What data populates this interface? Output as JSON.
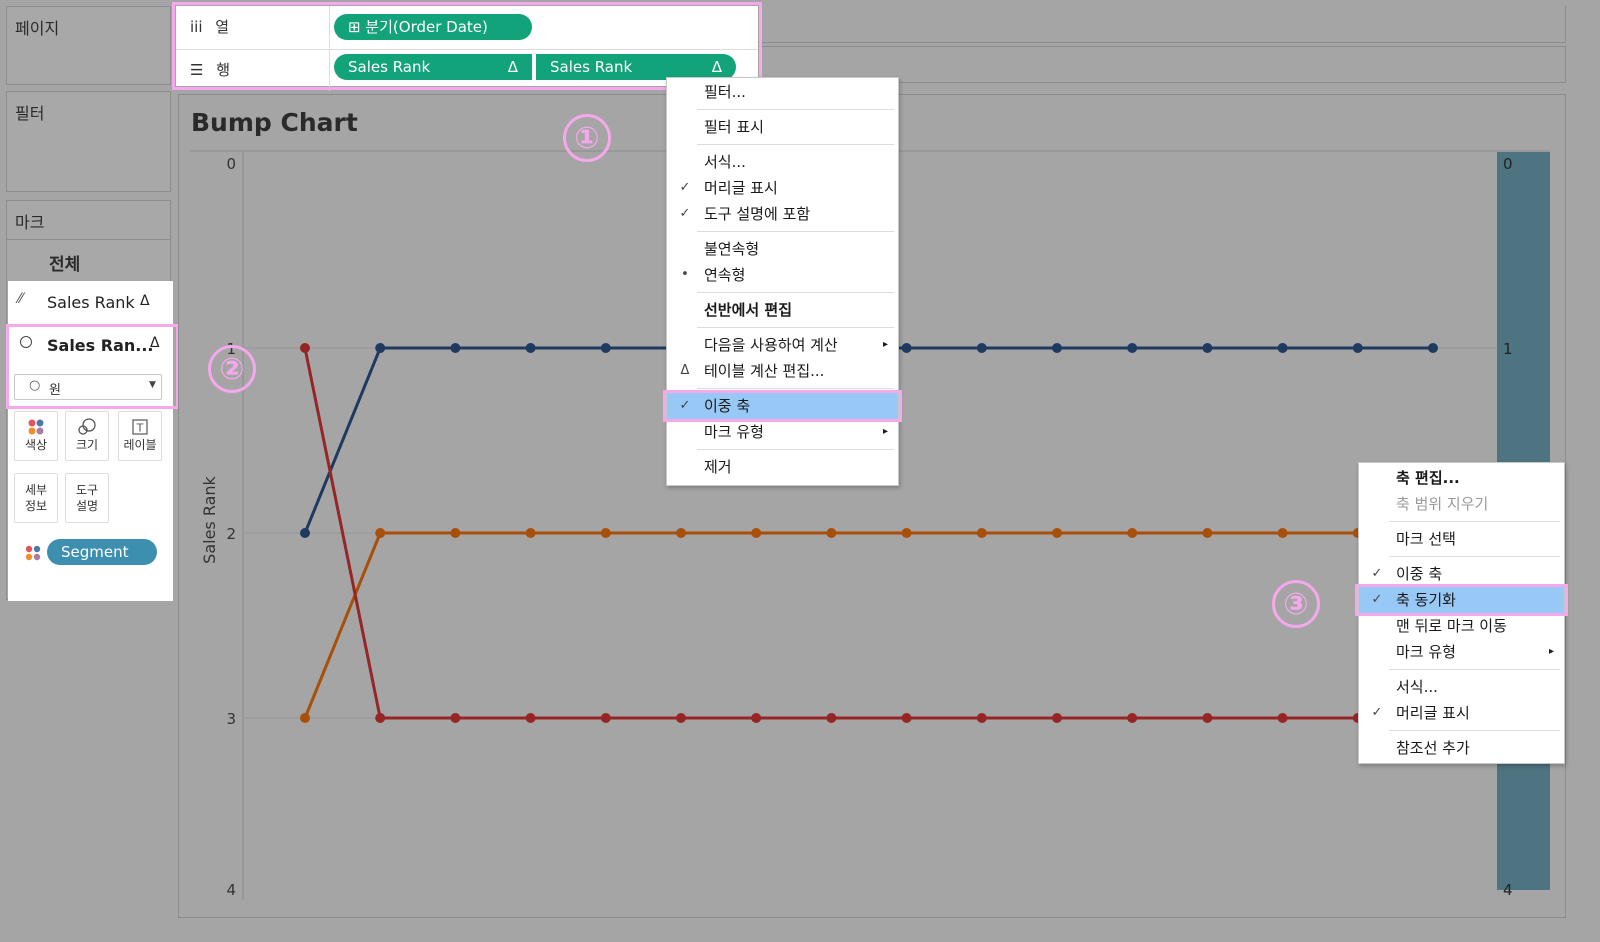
{
  "panels": {
    "pages_label": "페이지",
    "filters_label": "필터",
    "marks_label": "마크"
  },
  "marks": {
    "all_label": "전체",
    "layers": [
      {
        "icon": "line-chart-icon",
        "label": "Sales Rank",
        "delta": "Δ"
      },
      {
        "icon": "circle-outline-icon",
        "label": "Sales Ran...",
        "delta": "Δ"
      }
    ],
    "mark_type": {
      "icon": "○",
      "value": "원"
    },
    "tiles": [
      {
        "label": "색상",
        "icon": "color-dots-icon"
      },
      {
        "label": "크기",
        "icon": "size-circles-icon"
      },
      {
        "label": "레이블",
        "icon": "label-T-icon"
      },
      {
        "label": "세부\n정보",
        "icon": "detail-icon"
      },
      {
        "label": "도구\n설명",
        "icon": "tooltip-icon"
      }
    ],
    "segment_pill": "Segment"
  },
  "shelves": {
    "columns": {
      "icon": "iii",
      "label": "열",
      "pill": "⊞ 분기(Order Date)"
    },
    "rows": {
      "icon": "☰",
      "label": "행",
      "pills": [
        {
          "label": "Sales Rank",
          "delta": "Δ"
        },
        {
          "label": "Sales Rank",
          "delta": "Δ"
        }
      ]
    }
  },
  "chart_data": {
    "type": "line",
    "title": "Bump Chart",
    "ylabel": "Sales Rank",
    "ylim": [
      0,
      4
    ],
    "y_ticks": [
      "0",
      "1",
      "2",
      "3",
      "4"
    ],
    "right_axis_ticks": [
      "0",
      "1",
      "4"
    ],
    "x": [
      1,
      2,
      3,
      4,
      5,
      6,
      7,
      8,
      9,
      10,
      11,
      12,
      13,
      14,
      15,
      16
    ],
    "series": [
      {
        "color": "#1f3a5f",
        "values": [
          2,
          1,
          1,
          1,
          1,
          1,
          1,
          1,
          1,
          1,
          1,
          1,
          1,
          1,
          1,
          1
        ]
      },
      {
        "color": "#a8500a",
        "values": [
          3,
          2,
          2,
          2,
          2,
          2,
          2,
          2,
          2,
          2,
          2,
          2,
          2,
          2,
          2,
          2
        ]
      },
      {
        "color": "#962626",
        "values": [
          1,
          3,
          3,
          3,
          3,
          3,
          3,
          3,
          3,
          3,
          3,
          3,
          3,
          3,
          3,
          3
        ]
      }
    ],
    "grid": true
  },
  "pill_menu": {
    "items": [
      {
        "label": "필터...",
        "check": "",
        "arrow": ""
      },
      {
        "sep": true
      },
      {
        "label": "필터 표시",
        "check": "",
        "arrow": ""
      },
      {
        "sep": true
      },
      {
        "label": "서식...",
        "check": "",
        "arrow": ""
      },
      {
        "label": "머리글 표시",
        "check": "✓",
        "arrow": ""
      },
      {
        "label": "도구 설명에 포함",
        "check": "✓",
        "arrow": ""
      },
      {
        "sep": true
      },
      {
        "label": "불연속형",
        "check": "",
        "arrow": ""
      },
      {
        "label": "연속형",
        "check": "•",
        "arrow": ""
      },
      {
        "sep": true
      },
      {
        "label": "선반에서 편집",
        "check": "",
        "arrow": "",
        "bold": true
      },
      {
        "sep": true
      },
      {
        "label": "다음을 사용하여 계산",
        "check": "",
        "arrow": "▸"
      },
      {
        "label": "테이블 계산 편집...",
        "check": "Δ",
        "arrow": ""
      },
      {
        "sep": true
      },
      {
        "label": "이중 축",
        "check": "✓",
        "arrow": "",
        "highlight": true
      },
      {
        "label": "마크 유형",
        "check": "",
        "arrow": "▸"
      },
      {
        "sep": true
      },
      {
        "label": "제거",
        "check": "",
        "arrow": ""
      }
    ]
  },
  "axis_menu": {
    "items": [
      {
        "label": "축 편집...",
        "check": "",
        "arrow": "",
        "bold": true
      },
      {
        "label": "축 범위 지우기",
        "check": "",
        "arrow": "",
        "disabled": true
      },
      {
        "sep": true
      },
      {
        "label": "마크 선택",
        "check": "",
        "arrow": ""
      },
      {
        "sep": true
      },
      {
        "label": "이중 축",
        "check": "✓",
        "arrow": ""
      },
      {
        "label": "축 동기화",
        "check": "✓",
        "arrow": "",
        "highlight": true
      },
      {
        "label": "맨 뒤로 마크 이동",
        "check": "",
        "arrow": ""
      },
      {
        "label": "마크 유형",
        "check": "",
        "arrow": "▸"
      },
      {
        "sep": true
      },
      {
        "label": "서식...",
        "check": "",
        "arrow": ""
      },
      {
        "label": "머리글 표시",
        "check": "✓",
        "arrow": ""
      },
      {
        "sep": true
      },
      {
        "label": "참조선 추가",
        "check": "",
        "arrow": ""
      }
    ]
  },
  "annotations": [
    "①",
    "②",
    "③"
  ]
}
